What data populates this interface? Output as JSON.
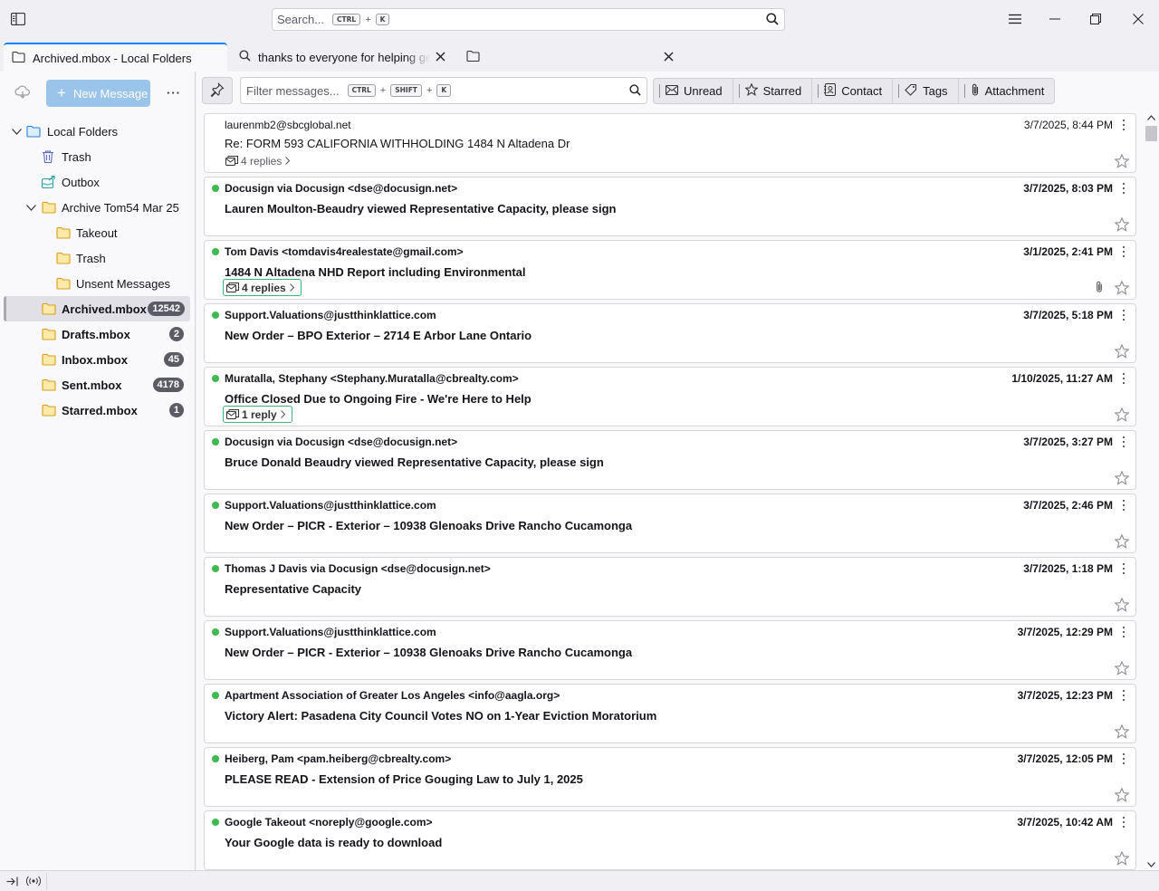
{
  "titlebar": {
    "search_placeholder": "Search...",
    "search_key1": "CTRL",
    "search_plus": "+",
    "search_key2": "K"
  },
  "tabs": [
    {
      "label": "Archived.mbox - Local Folders",
      "icon": "folder-icon",
      "active": true
    },
    {
      "label": "thanks to everyone for helping get t",
      "icon": "search-icon",
      "active": false
    },
    {
      "label": "",
      "icon": "folder-icon",
      "active": false
    }
  ],
  "folderpane": {
    "new_message_label": "New Message",
    "folders": [
      {
        "label": "Local Folders",
        "icon": "local-folders-icon",
        "count": ""
      },
      {
        "label": "Trash",
        "icon": "trash-icon",
        "count": ""
      },
      {
        "label": "Outbox",
        "icon": "outbox-icon",
        "count": ""
      },
      {
        "label": "Archive Tom54 Mar 25",
        "icon": "folder-icon",
        "count": ""
      },
      {
        "label": "Takeout",
        "icon": "folder-icon",
        "count": ""
      },
      {
        "label": "Trash",
        "icon": "folder-icon",
        "count": ""
      },
      {
        "label": "Unsent Messages",
        "icon": "folder-icon",
        "count": ""
      },
      {
        "label": "Archived.mbox",
        "icon": "folder-icon",
        "count": "12542"
      },
      {
        "label": "Drafts.mbox",
        "icon": "folder-icon",
        "count": "2"
      },
      {
        "label": "Inbox.mbox",
        "icon": "folder-icon",
        "count": "45"
      },
      {
        "label": "Sent.mbox",
        "icon": "folder-icon",
        "count": "4178"
      },
      {
        "label": "Starred.mbox",
        "icon": "folder-icon",
        "count": "1"
      }
    ]
  },
  "quickfilter": {
    "placeholder": "Filter messages...",
    "key1": "CTRL",
    "key2": "SHIFT",
    "key3": "K",
    "plus": "+",
    "buttons": [
      "Unread",
      "Starred",
      "Contact",
      "Tags",
      "Attachment"
    ]
  },
  "messages": [
    {
      "sender": "laurenmb2@sbcglobal.net",
      "date": "3/7/2025, 8:44 PM",
      "subject": "Re: FORM 593 CALIFORNIA WITHHOLDING 1484 N Altadena Dr",
      "replies": "4 replies",
      "unread": false,
      "attachment": false
    },
    {
      "sender": "Docusign via Docusign <dse@docusign.net>",
      "date": "3/7/2025, 8:03 PM",
      "subject": "Lauren Moulton-Beaudry viewed Representative Capacity, please sign",
      "replies": "",
      "unread": true,
      "attachment": false
    },
    {
      "sender": "Tom Davis <tomdavis4realestate@gmail.com>",
      "date": "3/1/2025, 2:41 PM",
      "subject": "1484 N Altadena NHD Report including Environmental",
      "replies": "4 replies",
      "unread": true,
      "attachment": true
    },
    {
      "sender": "Support.Valuations@justthinklattice.com",
      "date": "3/7/2025, 5:18 PM",
      "subject": "New Order – BPO Exterior – 2714 E Arbor Lane Ontario",
      "replies": "",
      "unread": true,
      "attachment": false
    },
    {
      "sender": "Muratalla, Stephany <Stephany.Muratalla@cbrealty.com>",
      "date": "1/10/2025, 11:27 AM",
      "subject": "Office Closed Due to Ongoing Fire - We're Here to Help",
      "replies": "1 reply",
      "unread": true,
      "attachment": false
    },
    {
      "sender": "Docusign via Docusign <dse@docusign.net>",
      "date": "3/7/2025, 3:27 PM",
      "subject": "Bruce Donald Beaudry viewed Representative Capacity, please sign",
      "replies": "",
      "unread": true,
      "attachment": false
    },
    {
      "sender": "Support.Valuations@justthinklattice.com",
      "date": "3/7/2025, 2:46 PM",
      "subject": "New Order – PICR - Exterior – 10938 Glenoaks Drive Rancho Cucamonga",
      "replies": "",
      "unread": true,
      "attachment": false
    },
    {
      "sender": "Thomas J Davis via Docusign <dse@docusign.net>",
      "date": "3/7/2025, 1:18 PM",
      "subject": "Representative Capacity",
      "replies": "",
      "unread": true,
      "attachment": false
    },
    {
      "sender": "Support.Valuations@justthinklattice.com",
      "date": "3/7/2025, 12:29 PM",
      "subject": "New Order – PICR - Exterior – 10938 Glenoaks Drive Rancho Cucamonga",
      "replies": "",
      "unread": true,
      "attachment": false
    },
    {
      "sender": "Apartment Association of Greater Los Angeles <info@aagla.org>",
      "date": "3/7/2025, 12:23 PM",
      "subject": "Victory Alert: Pasadena City Council Votes NO on 1-Year Eviction Moratorium",
      "replies": "",
      "unread": true,
      "attachment": false
    },
    {
      "sender": "Heiberg, Pam <pam.heiberg@cbrealty.com>",
      "date": "3/7/2025, 12:05 PM",
      "subject": "PLEASE READ - Extension of Price Gouging Law to July 1, 2025",
      "replies": "",
      "unread": true,
      "attachment": false
    },
    {
      "sender": "Google Takeout <noreply@google.com>",
      "date": "3/7/2025, 10:42 AM",
      "subject": "Your Google data is ready to download",
      "replies": "",
      "unread": true,
      "attachment": false
    }
  ],
  "colors": {
    "accent": "#0a84ff",
    "new_message_button": "#9ac4ea",
    "unread_dot": "#3fb950",
    "folder_icon": "#e8b32c"
  }
}
